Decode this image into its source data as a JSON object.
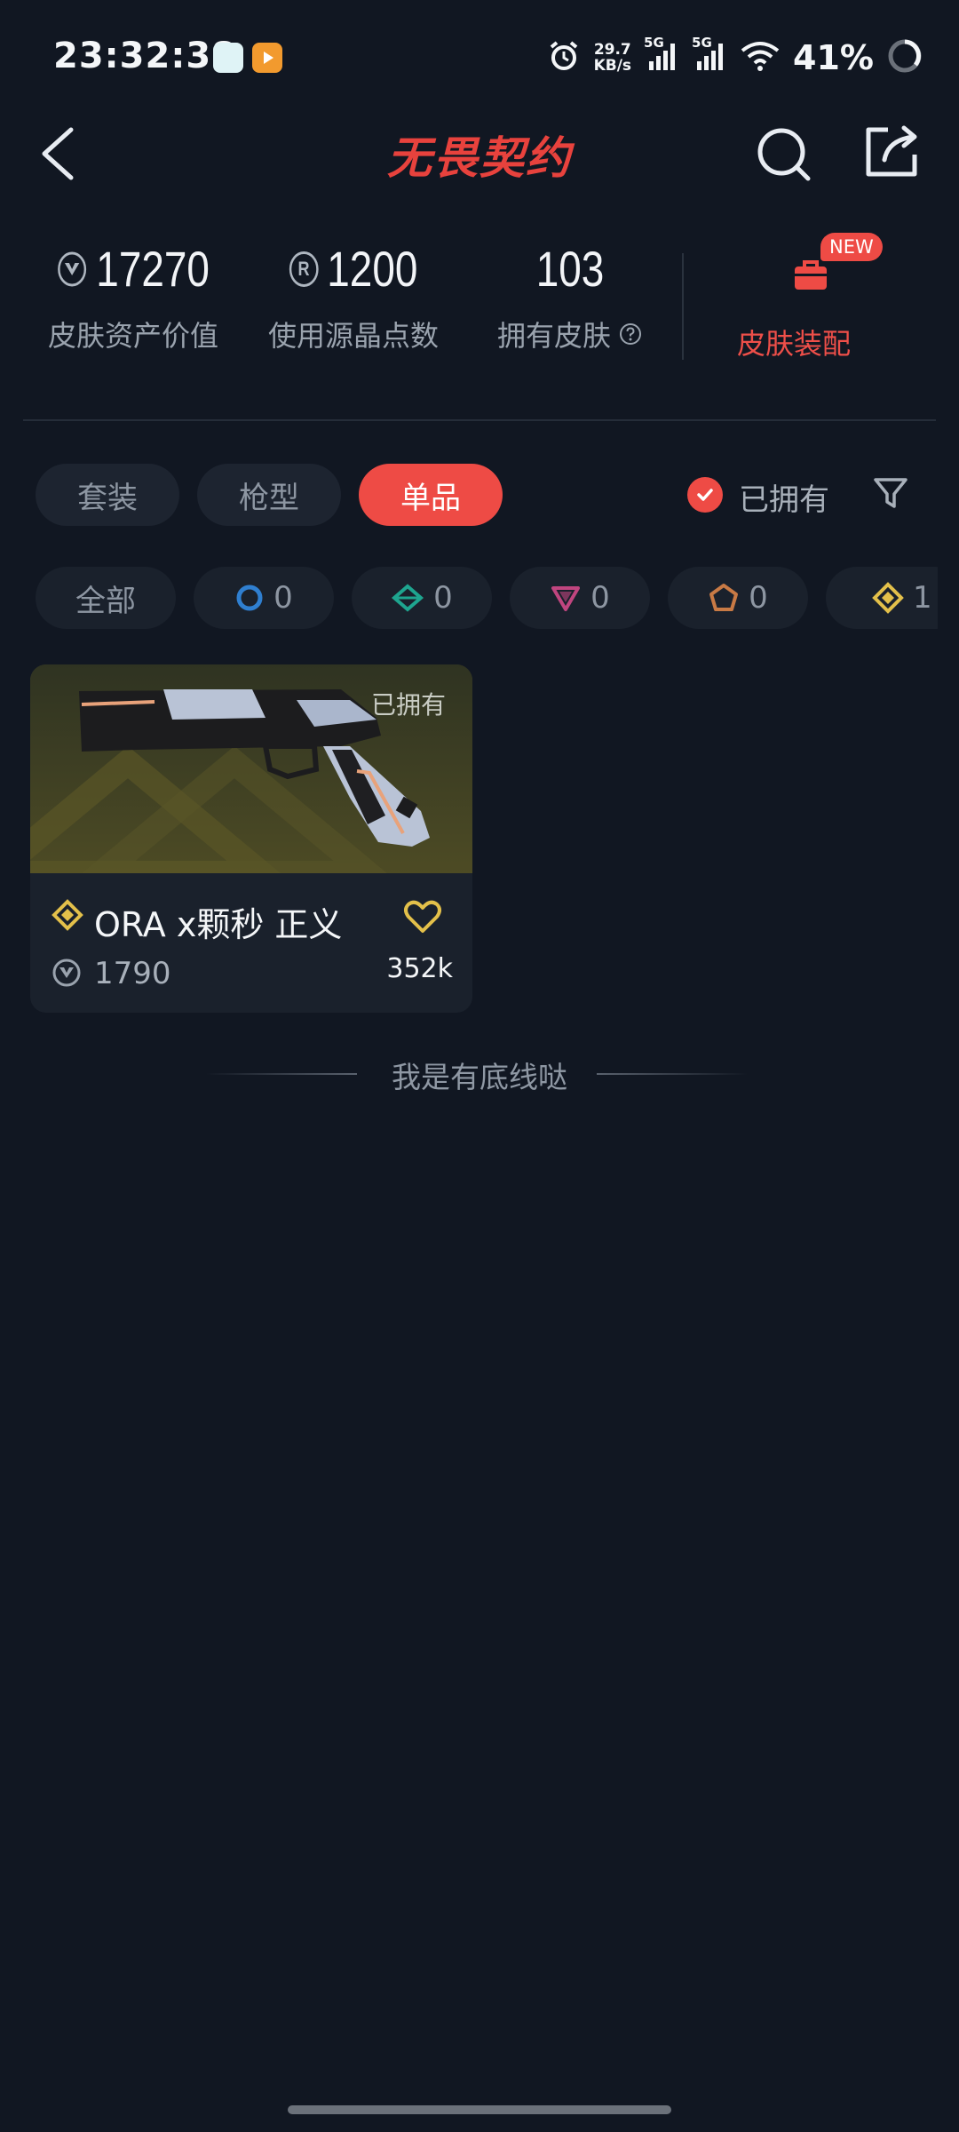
{
  "status_bar": {
    "time": "23:32:38",
    "net_speed_value": "29.7",
    "net_speed_unit": "KB/s",
    "signal1": "5G",
    "signal2": "5G",
    "battery": "41%"
  },
  "header": {
    "title": "无畏契约"
  },
  "stats": [
    {
      "value": "17270",
      "label": "皮肤资产价值",
      "icon": "valorant-point-icon"
    },
    {
      "value": "1200",
      "label": "使用源晶点数",
      "icon": "radianite-point-icon"
    },
    {
      "value": "103",
      "label": "拥有皮肤"
    }
  ],
  "equip": {
    "badge": "NEW",
    "label": "皮肤装配"
  },
  "tabs": [
    {
      "label": "套装",
      "active": false
    },
    {
      "label": "枪型",
      "active": false
    },
    {
      "label": "单品",
      "active": true
    }
  ],
  "owned_filter": {
    "label": "已拥有",
    "checked": true
  },
  "rarity_chips": [
    {
      "label": "全部"
    },
    {
      "count": "0",
      "icon": "select-tier-icon",
      "color": "#2f7fd0"
    },
    {
      "count": "0",
      "icon": "deluxe-tier-icon",
      "color": "#1ea58f"
    },
    {
      "count": "0",
      "icon": "premium-tier-icon",
      "color": "#c0457f"
    },
    {
      "count": "0",
      "icon": "exclusive-tier-icon",
      "color": "#c87a45"
    },
    {
      "count": "1",
      "icon": "ultra-tier-icon",
      "color": "#e3c04a"
    }
  ],
  "items": [
    {
      "owned_label": "已拥有",
      "name": "ORA x颗秒 正义",
      "price": "1790",
      "likes": "352k",
      "tier_color": "#e3c04a"
    }
  ],
  "footer": {
    "end_text": "我是有底线哒"
  },
  "colors": {
    "accent": "#ee4b45",
    "background": "#111722"
  }
}
